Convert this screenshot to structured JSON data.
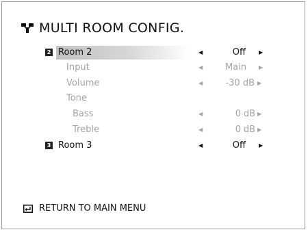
{
  "title": "MULTI ROOM CONFIG.",
  "rows": [
    {
      "badge": "2",
      "label": "Room 2",
      "value": "Off"
    },
    {
      "label": "Input",
      "value": "Main"
    },
    {
      "label": "Volume",
      "value": "-30 dB"
    },
    {
      "label": "Tone"
    },
    {
      "label": "Bass",
      "value_num": "0",
      "value_unit": "dB"
    },
    {
      "label": "Treble",
      "value_num": "0",
      "value_unit": "dB"
    },
    {
      "badge": "3",
      "label": "Room 3",
      "value": "Off"
    }
  ],
  "footer": {
    "label": "RETURN TO MAIN MENU"
  },
  "colors": {
    "highlight": "#c0c0c0",
    "dim_text": "#a3a3a3",
    "badge_bg": "#222222"
  },
  "icons": {
    "logo": "network-logo-icon",
    "return": "return-arrow-icon",
    "left": "left-arrow-icon",
    "right": "right-arrow-icon"
  }
}
